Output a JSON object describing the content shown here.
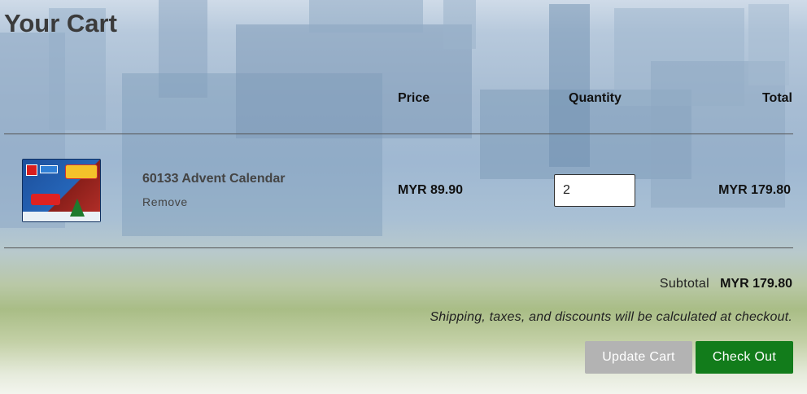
{
  "page": {
    "title": "Your Cart"
  },
  "table": {
    "headers": {
      "price": "Price",
      "quantity": "Quantity",
      "total": "Total"
    },
    "rows": [
      {
        "name": "60133 Advent Calendar",
        "remove_label": "Remove",
        "price": "MYR 89.90",
        "quantity": "2",
        "total": "MYR 179.80"
      }
    ]
  },
  "summary": {
    "subtotal_label": "Subtotal",
    "subtotal_value": "MYR 179.80",
    "shipping_note": "Shipping, taxes, and discounts will be calculated at checkout."
  },
  "actions": {
    "update_label": "Update Cart",
    "checkout_label": "Check Out"
  },
  "colors": {
    "checkout_button": "#127c1b",
    "update_button": "#b3b3b3",
    "title_text": "#3b3b3b"
  }
}
